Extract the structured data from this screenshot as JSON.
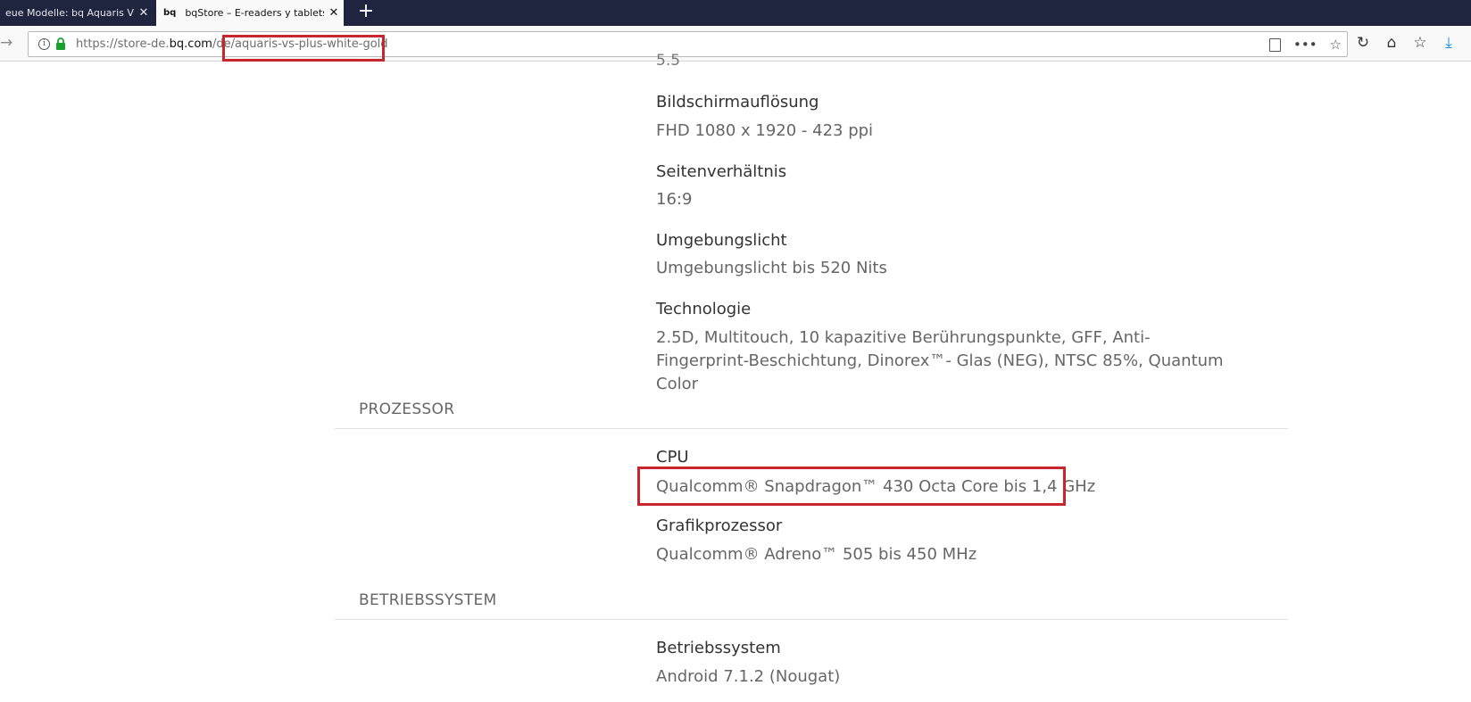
{
  "browser": {
    "tabs": [
      {
        "title": "eue Modelle: bq Aquaris VS u",
        "active": false
      },
      {
        "favicon": "bq",
        "title": "bqStore – E-readers y tablets bq",
        "active": true
      }
    ],
    "new_tab_label": "+",
    "url": {
      "prefix": "https://store-de.",
      "domain": "bq.com",
      "path": "/de/aquaris-vs-plus-white-gold"
    },
    "icons": [
      "back-arrow-icon",
      "info-icon",
      "lock-icon",
      "reader-view-icon",
      "more-actions-icon",
      "bookmark-star-icon",
      "reload-icon",
      "home-icon",
      "library-icon",
      "download-icon"
    ],
    "accent_color": "#1a8cd8",
    "tabbar_color": "#20253f"
  },
  "page": {
    "truncated_top": "5.5",
    "specs_display": [
      {
        "label": "Bildschirmauflösung",
        "value": "FHD 1080 x 1920 - 423 ppi"
      },
      {
        "label": "Seitenverhältnis",
        "value": "16:9"
      },
      {
        "label": "Umgebungslicht",
        "value": "Umgebungslicht bis 520 Nits"
      },
      {
        "label": "Technologie",
        "value": "2.5D, Multitouch, 10 kapazitive Berührungspunkte, GFF, Anti-Fingerprint-Beschichtung, Dinorex™- Glas (NEG), NTSC 85%, Quantum Color"
      }
    ],
    "sections": [
      {
        "title": "PROZESSOR",
        "specs": [
          {
            "label": "CPU",
            "value": "Qualcomm® Snapdragon™ 430 Octa Core bis 1,4 GHz"
          },
          {
            "label": "Grafikprozessor",
            "value": "Qualcomm® Adreno™ 505 bis 450 MHz"
          }
        ]
      },
      {
        "title": "BETRIEBSSYSTEM",
        "specs": [
          {
            "label": "Betriebssystem",
            "value": "Android 7.1.2 (Nougat)"
          }
        ]
      }
    ],
    "highlight_color": "#c8262f"
  }
}
